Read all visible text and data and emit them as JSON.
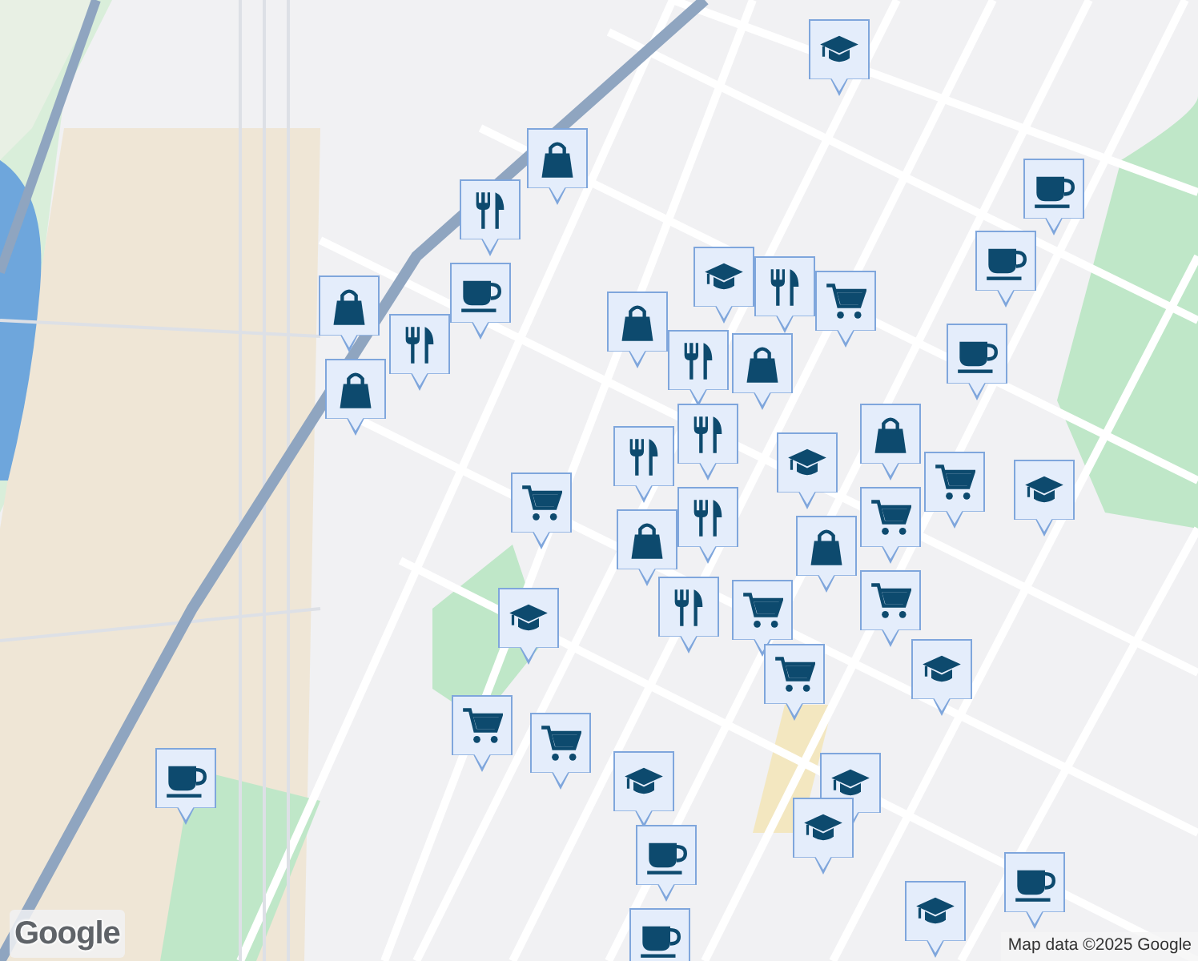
{
  "map": {
    "markers": [
      {
        "kind": "school"
      },
      {
        "kind": "shopping"
      },
      {
        "kind": "restaurant"
      },
      {
        "kind": "cafe"
      },
      {
        "kind": "cafe"
      },
      {
        "kind": "cafe"
      },
      {
        "kind": "shopping"
      },
      {
        "kind": "restaurant"
      },
      {
        "kind": "shopping"
      },
      {
        "kind": "school"
      },
      {
        "kind": "restaurant"
      },
      {
        "kind": "shopping"
      },
      {
        "kind": "grocery"
      },
      {
        "kind": "shopping"
      },
      {
        "kind": "restaurant"
      },
      {
        "kind": "cafe"
      },
      {
        "kind": "restaurant"
      },
      {
        "kind": "restaurant"
      },
      {
        "kind": "restaurant"
      },
      {
        "kind": "grocery"
      },
      {
        "kind": "school"
      },
      {
        "kind": "shopping"
      },
      {
        "kind": "grocery"
      },
      {
        "kind": "grocery"
      },
      {
        "kind": "shopping"
      },
      {
        "kind": "grocery"
      },
      {
        "kind": "grocery"
      },
      {
        "kind": "shopping"
      },
      {
        "kind": "restaurant"
      },
      {
        "kind": "school"
      },
      {
        "kind": "school"
      },
      {
        "kind": "school"
      },
      {
        "kind": "grocery"
      },
      {
        "kind": "grocery"
      },
      {
        "kind": "grocery"
      },
      {
        "kind": "school"
      },
      {
        "kind": "school"
      },
      {
        "kind": "school"
      },
      {
        "kind": "cafe"
      },
      {
        "kind": "cafe"
      },
      {
        "kind": "cafe"
      },
      {
        "kind": "school"
      },
      {
        "kind": "cafe"
      }
    ]
  },
  "logo": "Google",
  "attribution": "Map data ©2025 Google"
}
